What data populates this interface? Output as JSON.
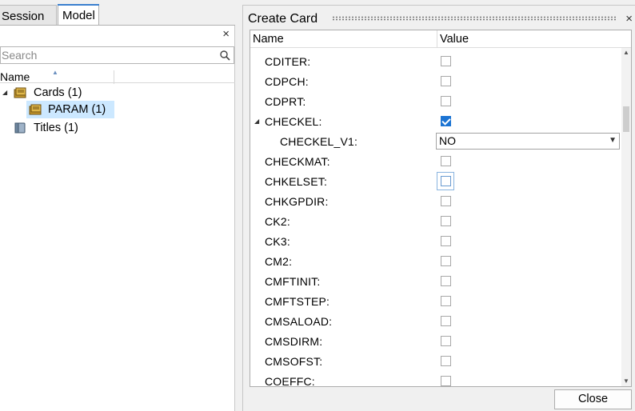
{
  "left_panel": {
    "tabs": [
      {
        "label": "Session"
      },
      {
        "label": "Model"
      }
    ],
    "close_symbol": "×",
    "search": {
      "placeholder": "Search"
    },
    "column_header": "Name",
    "tree": [
      {
        "label": "Cards  (1)",
        "icon": "cards-folder-icon",
        "expanded": true
      },
      {
        "label": "PARAM  (1)",
        "icon": "param-card-icon",
        "selected": true
      },
      {
        "label": "Titles  (1)",
        "icon": "titles-icon"
      }
    ]
  },
  "create_card": {
    "title": "Create Card",
    "close_symbol": "×",
    "columns": {
      "name": "Name",
      "value": "Value"
    },
    "rows": [
      {
        "name": "CDITER:",
        "checked": false
      },
      {
        "name": "CDPCH:",
        "checked": false
      },
      {
        "name": "CDPRT:",
        "checked": false
      },
      {
        "name": "CHECKEL:",
        "checked": true,
        "expanded": true
      },
      {
        "name": "CHECKEL_V1:",
        "select_value": "NO"
      },
      {
        "name": "CHECKMAT:",
        "checked": false
      },
      {
        "name": "CHKELSET:",
        "checked": false,
        "focused": true
      },
      {
        "name": "CHKGPDIR:",
        "checked": false
      },
      {
        "name": "CK2:",
        "checked": false
      },
      {
        "name": "CK3:",
        "checked": false
      },
      {
        "name": "CM2:",
        "checked": false
      },
      {
        "name": "CMFTINIT:",
        "checked": false
      },
      {
        "name": "CMFTSTEP:",
        "checked": false
      },
      {
        "name": "CMSALOAD:",
        "checked": false
      },
      {
        "name": "CMSDIRM:",
        "checked": false
      },
      {
        "name": "CMSOFST:",
        "checked": false
      },
      {
        "name": "COEFFC:",
        "checked": false
      }
    ],
    "close_button": "Close"
  },
  "colors": {
    "accent": "#1c74d3",
    "selection": "#cce8ff"
  }
}
